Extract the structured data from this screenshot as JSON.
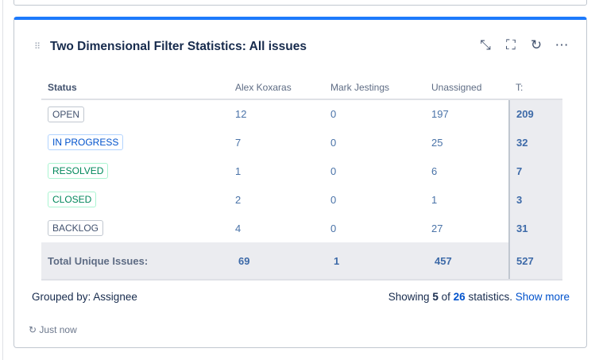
{
  "gadget": {
    "title": "Two Dimensional Filter Statistics: All issues",
    "icons": [
      "minimize-icon",
      "fullscreen-icon",
      "refresh-icon",
      "more-icon"
    ]
  },
  "table": {
    "headers": [
      "Status",
      "Alex Koxaras",
      "Mark Jestings",
      "Unassigned",
      "T:"
    ],
    "rows": [
      {
        "status": "OPEN",
        "values": [
          "12",
          "0",
          "197"
        ],
        "total": "209"
      },
      {
        "status": "IN PROGRESS",
        "values": [
          "7",
          "0",
          "25"
        ],
        "total": "32"
      },
      {
        "status": "RESOLVED",
        "values": [
          "1",
          "0",
          "6"
        ],
        "total": "7"
      },
      {
        "status": "CLOSED",
        "values": [
          "2",
          "0",
          "1"
        ],
        "total": "3"
      },
      {
        "status": "BACKLOG",
        "values": [
          "4",
          "0",
          "27"
        ],
        "total": "31"
      }
    ],
    "totals": {
      "label": "Total Unique Issues:",
      "values": [
        "69",
        "1",
        "457"
      ],
      "total": "527"
    }
  },
  "footer": {
    "grouped_by": "Grouped by: Assignee",
    "showing": "Showing",
    "shown": "5",
    "of": "of",
    "count": "26",
    "statistics": "statistics.",
    "show_more": "Show more",
    "updated": "Just now"
  }
}
